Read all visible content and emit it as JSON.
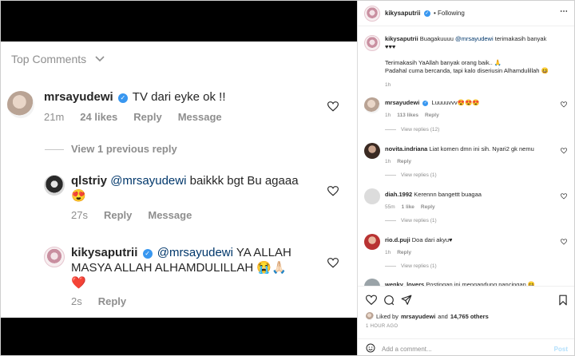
{
  "left": {
    "top_comments_label": "Top Comments",
    "comment1": {
      "username": "mrsayudewi",
      "text": "TV dari eyke ok !!",
      "time": "21m",
      "likes": "24 likes",
      "reply": "Reply",
      "message": "Message"
    },
    "view_previous": "View 1 previous reply",
    "comment2": {
      "username": "qlstriy",
      "mention": "@mrsayudewi",
      "text": "baikkk bgt Bu agaaa",
      "emoji": "😍",
      "time": "27s",
      "reply": "Reply",
      "message": "Message"
    },
    "comment3": {
      "username": "kikysaputrii",
      "mention": "@mrsayudewi",
      "text_line1": "YA ALLAH",
      "text_line2": "MASYA ALLAH ALHAMDULILLAH",
      "emoji_line2": "😭🙏🏻",
      "emoji_line3": "❤️",
      "time": "2s",
      "reply": "Reply"
    }
  },
  "right": {
    "header": {
      "username": "kikysaputrii",
      "dot": "•",
      "following": "Following"
    },
    "caption": {
      "username": "kikysaputrii",
      "text1": "Buagakuuuu",
      "mention": "@mrsayudewi",
      "text2": "terimakasih banyak",
      "hearts": "♥♥♥",
      "line2": "Terimakasih YaAllah banyak orang baik.. 🙏",
      "line3": "Padahal cuma bercanda, tapi kalo diseriusin Alhamdulillah 😆",
      "time": "1h"
    },
    "comments": [
      {
        "username": "mrsayudewi",
        "text": "Luuuuvvv😍😍😍",
        "time": "1h",
        "likes": "113 likes",
        "reply": "Reply",
        "view": "View replies (12)"
      },
      {
        "username": "novita.indriana",
        "text": "Liat komen dmn ini sih. Nyari2 gk nemu",
        "time": "1h",
        "reply": "Reply",
        "view": "View replies (1)"
      },
      {
        "username": "diah.1992",
        "text": "Kerennn bangettt buagaa",
        "time": "55m",
        "likes": "1 like",
        "reply": "Reply",
        "view": "View replies (1)"
      },
      {
        "username": "rio.d.puji",
        "text": "Doa dari akyu♥",
        "time": "1h",
        "reply": "Reply",
        "view": "View replies (1)"
      },
      {
        "username": "wenky_lovers",
        "text": "Postingan ini mengandung pancingan 😆"
      }
    ],
    "liked_by": {
      "prefix": "Liked by",
      "user": "mrsayudewi",
      "middle": "and",
      "count": "14,765 others"
    },
    "time_ago": "1 HOUR AGO",
    "add_comment_placeholder": "Add a comment...",
    "post_label": "Post"
  },
  "colors": {
    "link": "#00376b",
    "verified": "#3897f0",
    "meta": "#8e8e8e",
    "heart_red": "#ed4956"
  }
}
